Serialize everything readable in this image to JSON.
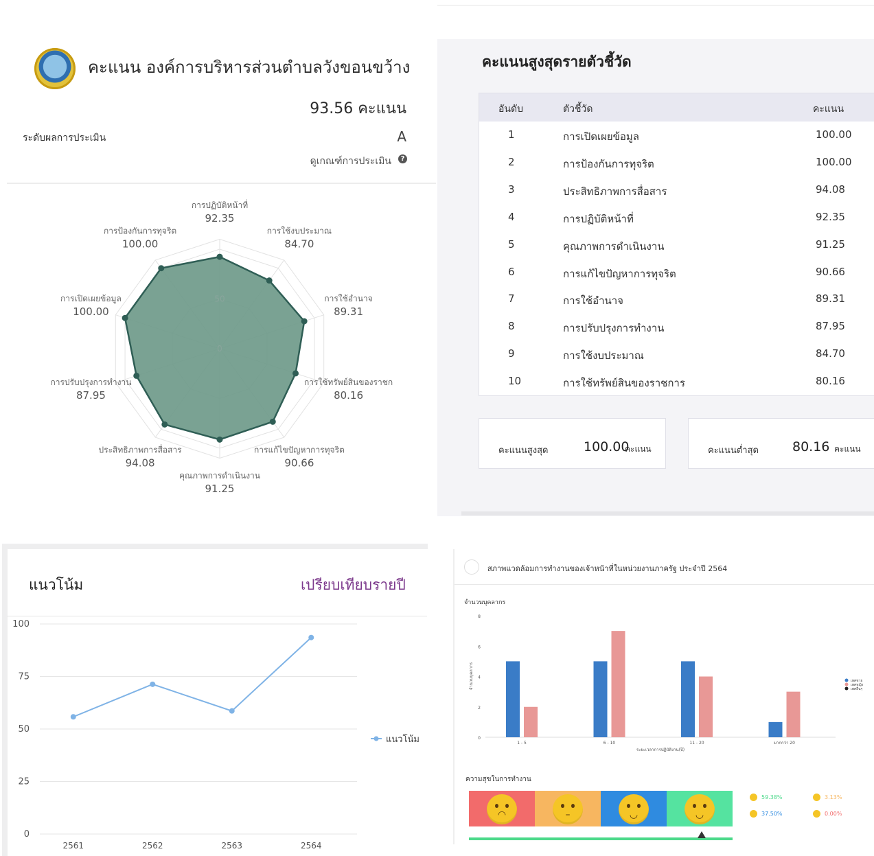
{
  "org": {
    "title": "คะแนน องค์การบริหารส่วนตำบลวังขอนขว้าง",
    "total_score": "93.56 คะแนน",
    "grade_label": "ระดับผลการประเมิน",
    "grade_value": "A",
    "criteria_link": "ดูเกณฑ์การประเมิน"
  },
  "radar": {
    "max": 100,
    "scale_labels": [
      "0",
      "50"
    ],
    "axes": [
      {
        "label": "การปฏิบัติหน้าที่",
        "value": 92.35,
        "value_text": "92.35"
      },
      {
        "label": "การใช้งบประมาณ",
        "value": 84.7,
        "value_text": "84.70"
      },
      {
        "label": "การใช้อำนาจ",
        "value": 89.31,
        "value_text": "89.31"
      },
      {
        "label": "การใช้ทรัพย์สินของราชก",
        "value": 80.16,
        "value_text": "80.16"
      },
      {
        "label": "การแก้ไขปัญหาการทุจริต",
        "value": 90.66,
        "value_text": "90.66"
      },
      {
        "label": "คุณภาพการดำเนินงาน",
        "value": 91.25,
        "value_text": "91.25"
      },
      {
        "label": "ประสิทธิภาพการสื่อสาร",
        "value": 94.08,
        "value_text": "94.08"
      },
      {
        "label": "การปรับปรุงการทำงาน",
        "value": 87.95,
        "value_text": "87.95"
      },
      {
        "label": "การเปิดเผยข้อมูล",
        "value": 100.0,
        "value_text": "100.00"
      },
      {
        "label": "การป้องกันการทุจริต",
        "value": 100.0,
        "value_text": "100.00"
      }
    ]
  },
  "indicators": {
    "title": "คะแนนสูงสุดรายตัวชี้วัด",
    "col_rank": "อันดับ",
    "col_indicator": "ตัวชี้วัด",
    "col_score": "คะแนน",
    "rows": [
      {
        "rank": "1",
        "name": "การเปิดเผยข้อมูล",
        "score": "100.00"
      },
      {
        "rank": "2",
        "name": "การป้องกันการทุจริต",
        "score": "100.00"
      },
      {
        "rank": "3",
        "name": "ประสิทธิภาพการสื่อสาร",
        "score": "94.08"
      },
      {
        "rank": "4",
        "name": "การปฏิบัติหน้าที่",
        "score": "92.35"
      },
      {
        "rank": "5",
        "name": "คุณภาพการดำเนินงาน",
        "score": "91.25"
      },
      {
        "rank": "6",
        "name": "การแก้ไขปัญหาการทุจริต",
        "score": "90.66"
      },
      {
        "rank": "7",
        "name": "การใช้อำนาจ",
        "score": "89.31"
      },
      {
        "rank": "8",
        "name": "การปรับปรุงการทำงาน",
        "score": "87.95"
      },
      {
        "rank": "9",
        "name": "การใช้งบประมาณ",
        "score": "84.70"
      },
      {
        "rank": "10",
        "name": "การใช้ทรัพย์สินของราชการ",
        "score": "80.16"
      }
    ],
    "max_label": "คะแนนสูงสุด",
    "max_value": "100.00",
    "max_unit": "คะแนน",
    "min_label": "คะแนนต่ำสุด",
    "min_value": "80.16",
    "min_unit": "คะแนน"
  },
  "trend": {
    "title": "แนวโน้ม",
    "compare_link": "เปรียบเทียบรายปี"
  },
  "chart_data": [
    {
      "type": "line",
      "x": [
        "2561",
        "2562",
        "2563",
        "2564"
      ],
      "series": [
        {
          "name": "แนวโน้ม",
          "values": [
            55.8,
            71.3,
            58.6,
            93.56
          ]
        }
      ],
      "ylim": [
        0,
        100
      ],
      "yticks": [
        0,
        25,
        50,
        75,
        100
      ],
      "grid": true,
      "legend": "right",
      "colors": {
        "line": "#7fb3e6"
      }
    },
    {
      "type": "bar",
      "title": "สภาพแวดล้อมการทำงานของเจ้าหน้าที่ในหน่วยงานภาครัฐ ประจำปี 2564",
      "ylabel": "จำนวนบุคลากร",
      "xlabel": "ระยะเวลาการปฏิบัติงาน(ปี)",
      "categories": [
        "1 - 5",
        "6 - 10",
        "11 - 20",
        "มากกว่า 20"
      ],
      "ylim": [
        0,
        8
      ],
      "yticks": [
        0,
        2,
        4,
        6,
        8
      ],
      "series": [
        {
          "name": "เพศชาย",
          "values": [
            5,
            5,
            5,
            1
          ],
          "color": "#3a7cc7"
        },
        {
          "name": "เพศหญิง",
          "values": [
            2,
            7,
            4,
            3
          ],
          "color": "#e89896"
        },
        {
          "name": "เพศอื่นๆ",
          "values": [
            0,
            0,
            0,
            0
          ],
          "color": "#222222"
        }
      ],
      "legend": "right"
    }
  ],
  "happiness": {
    "title": "ความสุขในการทำงาน",
    "moods": [
      {
        "color": "#f26b6b",
        "face": "sad"
      },
      {
        "color": "#f7b660",
        "face": "neutral"
      },
      {
        "color": "#2f8be0",
        "face": "smile"
      },
      {
        "color": "#55e3a0",
        "face": "happy"
      }
    ],
    "stats": [
      {
        "value": "59.38%",
        "color": "#4cd98a"
      },
      {
        "value": "3.13%",
        "color": "#f7b660"
      },
      {
        "value": "37.50%",
        "color": "#2f8be0"
      },
      {
        "value": "0.00%",
        "color": "#f26b6b"
      }
    ]
  }
}
